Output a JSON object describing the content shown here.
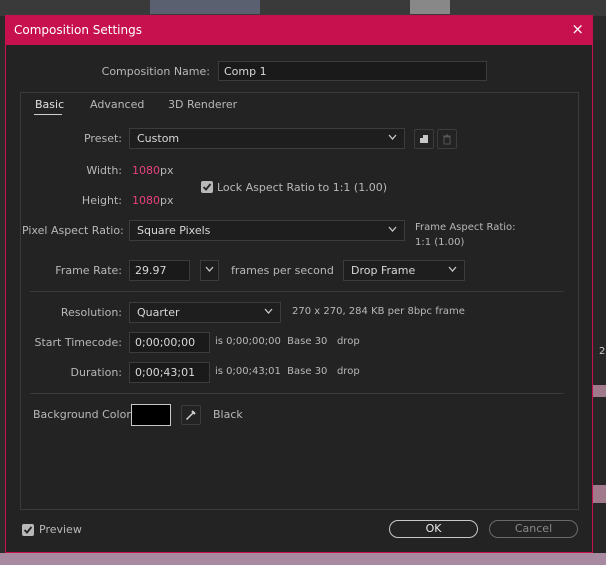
{
  "dialog": {
    "title": "Composition Settings",
    "close_glyph": "×",
    "comp_name_label": "Composition Name:",
    "comp_name_value": "Comp 1"
  },
  "tabs": [
    {
      "label": "Basic",
      "active": true
    },
    {
      "label": "Advanced",
      "active": false
    },
    {
      "label": "3D Renderer",
      "active": false
    }
  ],
  "basic": {
    "preset_label": "Preset:",
    "preset_value": "Custom",
    "width_label": "Width:",
    "width_value": "1080",
    "width_unit": "px",
    "height_label": "Height:",
    "height_value": "1080",
    "height_unit": "px",
    "lock_aspect_label": "Lock Aspect Ratio to 1:1 (1.00)",
    "lock_aspect_checked": true,
    "par_label": "Pixel Aspect Ratio:",
    "par_value": "Square Pixels",
    "frame_aspect_label": "Frame Aspect Ratio:",
    "frame_aspect_value": "1:1 (1.00)",
    "frame_rate_label": "Frame Rate:",
    "frame_rate_value": "29.97",
    "frame_rate_unit": "frames per second",
    "drop_frame_value": "Drop Frame",
    "resolution_label": "Resolution:",
    "resolution_value": "Quarter",
    "resolution_info": "270 x 270, 284 KB per 8bpc frame",
    "start_tc_label": "Start Timecode:",
    "start_tc_value": "0;00;00;00",
    "start_tc_info": "is 0;00;00;00  Base 30   drop",
    "duration_label": "Duration:",
    "duration_value": "0;00;43;01",
    "duration_info": "is 0;00;43;01  Base 30   drop",
    "bg_color_label": "Background Color:",
    "bg_color_name": "Black",
    "bg_color_hex": "#000000"
  },
  "footer": {
    "preview_label": "Preview",
    "preview_checked": true,
    "ok_label": "OK",
    "cancel_label": "Cancel"
  },
  "colors": {
    "accent": "#c7114e",
    "highlight_value": "#e8417f"
  },
  "background": {
    "side_number": "2"
  }
}
